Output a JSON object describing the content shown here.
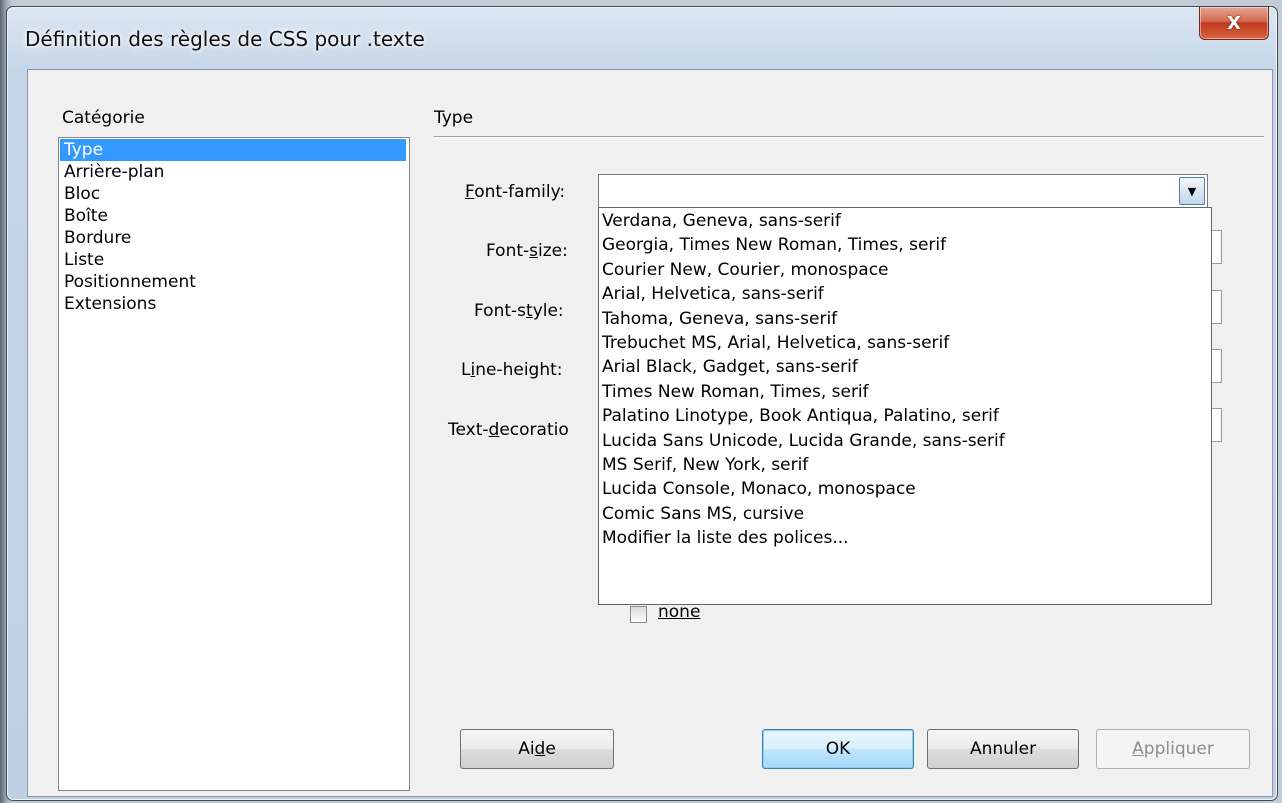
{
  "window": {
    "title": "Définition des règles de CSS pour .texte",
    "close_label": "X"
  },
  "categories": {
    "label": "Catégorie",
    "items": [
      "Type",
      "Arrière-plan",
      "Bloc",
      "Boîte",
      "Bordure",
      "Liste",
      "Positionnement",
      "Extensions"
    ],
    "selected": "Type"
  },
  "section": {
    "title": "Type"
  },
  "fields": {
    "font_family": {
      "label_first": "F",
      "label_rest": "ont-family:",
      "value": ""
    },
    "font_size": {
      "label_pre": "Font-",
      "label_u": "s",
      "label_post": "ize:"
    },
    "font_style": {
      "label_pre": "Font-s",
      "label_u": "t",
      "label_post": "yle:"
    },
    "line_height": {
      "label_pre": "L",
      "label_u": "i",
      "label_post": "ne-height:"
    },
    "text_decoration": {
      "label_pre": "Text-",
      "label_u": "d",
      "label_post": "ecoratio"
    }
  },
  "font_options": [
    "Verdana, Geneva, sans-serif",
    "Georgia, Times New Roman, Times, serif",
    "Courier New, Courier, monospace",
    "Arial, Helvetica, sans-serif",
    "Tahoma, Geneva, sans-serif",
    "Trebuchet MS, Arial, Helvetica, sans-serif",
    "Arial Black, Gadget, sans-serif",
    "Times New Roman, Times, serif",
    "Palatino Linotype, Book Antiqua, Palatino, serif",
    "Lucida Sans Unicode, Lucida Grande, sans-serif",
    "MS Serif, New York, serif",
    "Lucida Console, Monaco, monospace",
    "Comic Sans MS, cursive",
    "Modifier la liste des polices..."
  ],
  "decoration": {
    "none_label": "none",
    "none_checked": false
  },
  "buttons": {
    "help_pre": "Ai",
    "help_u": "d",
    "help_post": "e",
    "ok": "OK",
    "cancel": "Annuler",
    "apply_u": "A",
    "apply_rest": "ppliquer"
  }
}
